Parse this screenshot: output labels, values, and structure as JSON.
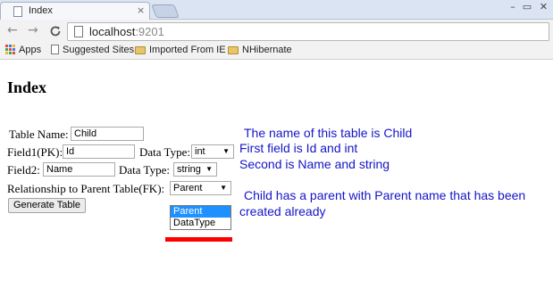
{
  "browser": {
    "tab_title": "Index",
    "tab_close": "×",
    "window_controls": {
      "minimize": "–",
      "maximize": "▭",
      "close": "✕"
    },
    "nav": {
      "back": "←",
      "forward": "→",
      "reload": "C"
    },
    "url_host": "localhost",
    "url_port": ":9201",
    "bookmarks": [
      {
        "label": "Apps",
        "icon": "apps-grid-icon"
      },
      {
        "label": "Suggested Sites",
        "icon": "page-icon"
      },
      {
        "label": "Imported From IE",
        "icon": "folder-icon"
      },
      {
        "label": "NHibernate",
        "icon": "folder-icon"
      }
    ]
  },
  "page": {
    "heading": "Index",
    "table_name_label": "Table Name:",
    "table_name_value": "Child",
    "field1_label": "Field1(PK):",
    "field1_value": "Id",
    "datatype1_label": "Data Type:",
    "datatype1_value": "int",
    "field2_label": "Field2:",
    "field2_value": "Name",
    "datatype2_label": "Data Type:",
    "datatype2_value": "string",
    "relationship_label": "Relationship to Parent Table(FK):",
    "relationship_value": "Parent",
    "relationship_options": [
      "Parent",
      "DataType"
    ],
    "generate_button": "Generate Table",
    "dropdown_arrow": "▼"
  },
  "annotations": {
    "note1": "The name of this table is Child",
    "note2": "First field is Id and int",
    "note3": "Second is Name and string",
    "note4": "Child has a parent with Parent name that has been",
    "note5": "created already"
  },
  "colors": {
    "annotation_text": "#1515c8",
    "highlight_bar": "#ff0000",
    "selected_option": "#1e90ff"
  }
}
